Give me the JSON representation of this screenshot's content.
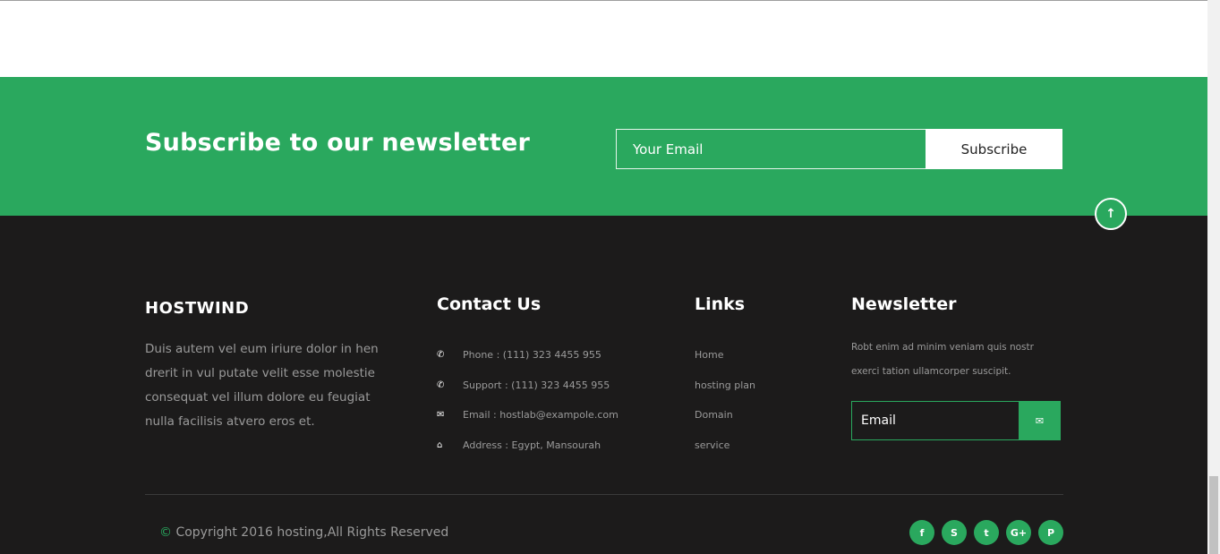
{
  "subscribe": {
    "title": "Subscribe to our newsletter",
    "email_placeholder": "Your Email",
    "button_label": "Subscribe"
  },
  "back_to_top": {
    "icon": "arrow-up-icon",
    "glyph": "↑"
  },
  "footer": {
    "brand": "HOSTWIND",
    "about": "Duis autem vel eum iriure dolor in hen drerit in vul putate velit esse molestie consequat vel illum dolore eu feugiat nulla facilisis atvero eros et.",
    "contact": {
      "title": "Contact Us",
      "items": [
        {
          "icon": "phone-icon",
          "glyph": "✆",
          "text": "Phone : (111) 323 4455 955"
        },
        {
          "icon": "phone-icon",
          "glyph": "✆",
          "text": "Support : (111) 323 4455 955"
        },
        {
          "icon": "envelope-icon",
          "glyph": "✉",
          "text": "Email : hostlab@exampole.com"
        },
        {
          "icon": "home-icon",
          "glyph": "⌂",
          "text": "Address : Egypt, Mansourah"
        }
      ]
    },
    "links": {
      "title": "Links",
      "items": [
        "Home",
        "hosting plan",
        "Domain",
        "service"
      ]
    },
    "newsletter": {
      "title": "Newsletter",
      "text": "Robt enim ad minim veniam quis nostr exerci tation ullamcorper suscipit.",
      "email_placeholder": "Email",
      "send_icon": "send-icon",
      "send_glyph": "✉"
    },
    "copyright_symbol": "©",
    "copyright": " Copyright 2016 hosting,All Rights Reserved",
    "socials": [
      {
        "name": "facebook-icon",
        "glyph": "f"
      },
      {
        "name": "skype-icon",
        "glyph": "S"
      },
      {
        "name": "twitter-icon",
        "glyph": "t"
      },
      {
        "name": "google-plus-icon",
        "glyph": "G+"
      },
      {
        "name": "pinterest-icon",
        "glyph": "P"
      }
    ]
  },
  "colors": {
    "accent": "#2aa85e",
    "footer_bg": "#1c1b1b",
    "muted_text": "#9a9a9a"
  }
}
